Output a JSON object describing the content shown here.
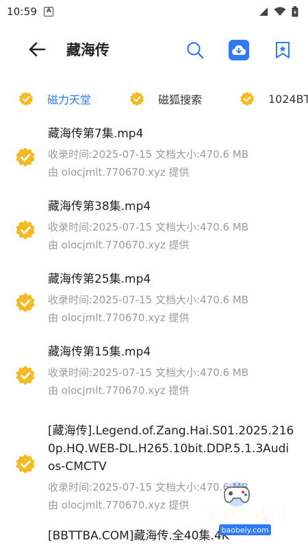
{
  "status": {
    "time": "10:59",
    "notification_letter": "A"
  },
  "header": {
    "title": "藏海传"
  },
  "tabs": [
    {
      "label": "磁力天堂",
      "active": true
    },
    {
      "label": "磁狐搜索",
      "active": false
    },
    {
      "label": "1024BT",
      "active": false
    }
  ],
  "items": [
    {
      "title": "藏海传第7集.mp4",
      "meta": "收录时间:2025-07-15  文档大小:470.6 MB",
      "provider": "由 olocjmlt.770670.xyz 提供"
    },
    {
      "title": "藏海传第38集.mp4",
      "meta": "收录时间:2025-07-15  文档大小:470.6 MB",
      "provider": "由 olocjmlt.770670.xyz 提供"
    },
    {
      "title": "藏海传第25集.mp4",
      "meta": "收录时间:2025-07-15  文档大小:470.6 MB",
      "provider": "由 olocjmlt.770670.xyz 提供"
    },
    {
      "title": "藏海传第15集.mp4",
      "meta": "收录时间:2025-07-15  文档大小:470.6 MB",
      "provider": "由 olocjmlt.770670.xyz 提供"
    },
    {
      "title": "[藏海传].Legend.of.Zang.Hai.S01.2025.2160p.HQ.WEB-DL.H265.10bit.DDP.5.1.3Audios-CMCTV",
      "meta": "收录时间:2025-07-15  文档大小:470.6 MB",
      "provider": "由 olocjmlt.770670.xyz 提供"
    },
    {
      "title": "[BBTTBA.COM]藏海传.全40集.4K",
      "meta": "",
      "provider": ""
    }
  ],
  "watermark": {
    "name": "宝贝游戏网",
    "domain": "baobeiy.com"
  },
  "colors": {
    "accent": "#2f7bf5",
    "badge": "#f5b921",
    "muted": "#9a9a9a"
  }
}
